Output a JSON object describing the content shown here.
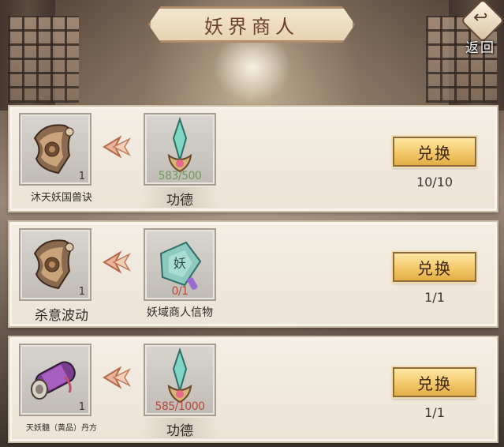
{
  "header": {
    "title": "妖界商人",
    "return_label": "返回"
  },
  "rows": [
    {
      "reward": {
        "name": "沐天妖国兽诀",
        "count": "1",
        "icon": "scroll-icon"
      },
      "cost": {
        "name": "功德",
        "progress": "583/500",
        "progress_color": "#6f9a5a",
        "icon": "jade-dagger-icon"
      },
      "button": "兑换",
      "limit": "10/10"
    },
    {
      "reward": {
        "name": "杀意波动",
        "count": "1",
        "icon": "scroll-icon"
      },
      "cost": {
        "name": "妖域商人信物",
        "progress": "0/1",
        "progress_color": "#b8483a",
        "icon": "jade-token-icon"
      },
      "button": "兑换",
      "limit": "1/1"
    },
    {
      "reward": {
        "name": "天妖髓（黄品）丹方",
        "count": "1",
        "icon": "purple-scroll-icon"
      },
      "cost": {
        "name": "功德",
        "progress": "585/1000",
        "progress_color": "#b8483a",
        "icon": "jade-dagger-icon"
      },
      "button": "兑换",
      "limit": "1/1"
    }
  ]
}
